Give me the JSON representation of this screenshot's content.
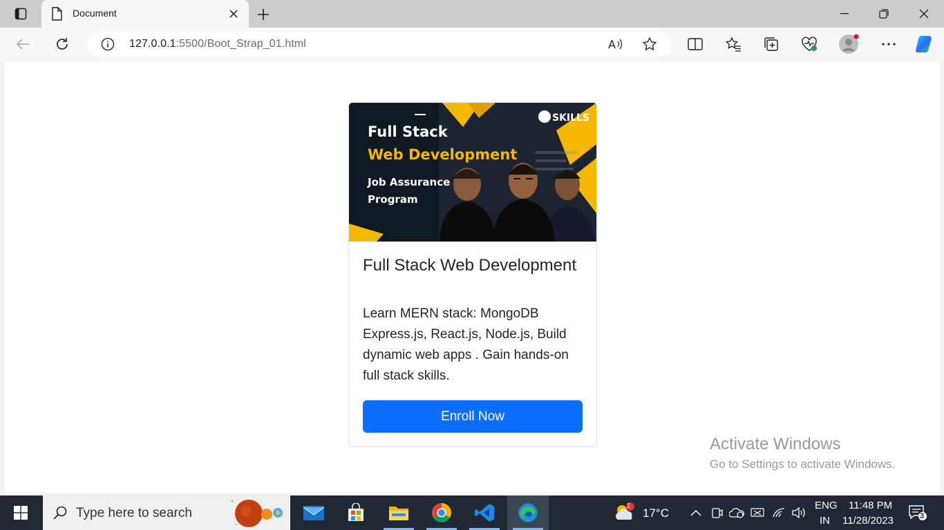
{
  "browser": {
    "tab_title": "Document",
    "url_host": "127.0.0.1",
    "url_rest": ":5500/Boot_Strap_01.html"
  },
  "banner": {
    "brand": "SKILLS",
    "line1": "Full Stack",
    "line2": "Web Development",
    "line3": "Job Assurance",
    "line4": "Program"
  },
  "card": {
    "title": "Full Stack Web Development",
    "text": "Learn MERN stack: MongoDB Express.js, React.js, Node.js, Build dynamic web apps . Gain hands-on full stack skills.",
    "button": "Enroll Now"
  },
  "watermark": {
    "title": "Activate Windows",
    "subtitle": "Go to Settings to activate Windows."
  },
  "taskbar": {
    "search_placeholder": "Type here to search",
    "weather_temp": "17°C",
    "weather_badge": "1",
    "lang_top": "ENG",
    "lang_bottom": "IN",
    "time": "11:48 PM",
    "date": "11/28/2023",
    "notification_count": "3"
  },
  "colors": {
    "primary_button": "#0d6efd",
    "banner_accent": "#f5b800",
    "taskbar_bg": "#1f2833"
  }
}
